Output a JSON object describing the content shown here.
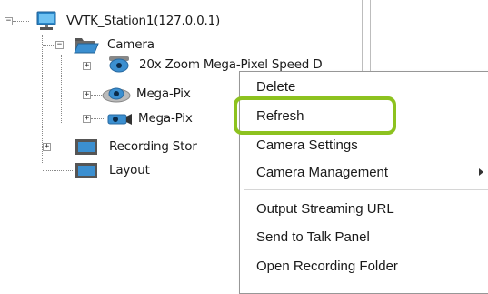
{
  "tree": {
    "station": {
      "label": "VVTK_Station1(127.0.0.1)",
      "icon": "monitor-icon"
    },
    "camera_folder": {
      "label": "Camera",
      "icon": "folder-open-icon"
    },
    "cameras": [
      {
        "label": "20x Zoom Mega-Pixel Speed D",
        "icon": "speed-dome-camera-icon"
      },
      {
        "label": "Mega-Pix",
        "icon": "dome-camera-icon"
      },
      {
        "label": "Mega-Pix",
        "icon": "box-camera-icon"
      }
    ],
    "recording_storage": {
      "label": "Recording Stor",
      "icon": "storage-icon"
    },
    "layout": {
      "label": "Layout",
      "icon": "layout-icon"
    }
  },
  "context_menu": {
    "items": [
      {
        "label": "Delete"
      },
      {
        "label": "Refresh"
      },
      {
        "label": "Camera Settings"
      },
      {
        "label": "Camera Management",
        "has_submenu": true
      },
      {
        "label": "Output Streaming URL"
      },
      {
        "label": "Send to Talk Panel"
      },
      {
        "label": "Open Recording Folder"
      }
    ],
    "highlighted_item": "Refresh"
  },
  "colors": {
    "highlight_border": "#8dc21f",
    "icon_blue": "#2a86c8"
  }
}
